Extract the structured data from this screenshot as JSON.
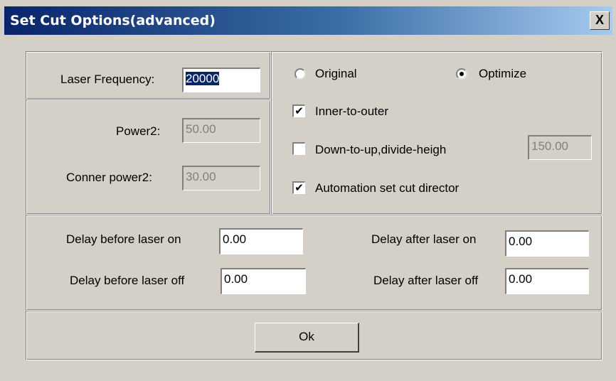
{
  "window": {
    "title": "Set Cut Options(advanced)",
    "close_label": "X"
  },
  "laser": {
    "frequency_label": "Laser Frequency:",
    "frequency_value": "20000",
    "power2_label": "Power2:",
    "power2_value": "50.00",
    "corner_power2_label": "Conner power2:",
    "corner_power2_value": "30.00"
  },
  "options": {
    "original_label": "Original",
    "original_selected": false,
    "optimize_label": "Optimize",
    "optimize_selected": true,
    "inner_to_outer_label": "Inner-to-outer",
    "inner_to_outer_checked": true,
    "down_to_up_label": "Down-to-up,divide-heigh",
    "down_to_up_checked": false,
    "divide_height_value": "150.00",
    "auto_direction_label": "Automation set cut director",
    "auto_direction_checked": true
  },
  "delays": {
    "before_on_label": "Delay before laser on",
    "before_on_value": "0.00",
    "after_on_label": "Delay after laser on",
    "after_on_value": "0.00",
    "before_off_label": "Delay before laser off",
    "before_off_value": "0.00",
    "after_off_label": "Delay after laser off",
    "after_off_value": "0.00"
  },
  "buttons": {
    "ok_label": "Ok"
  }
}
